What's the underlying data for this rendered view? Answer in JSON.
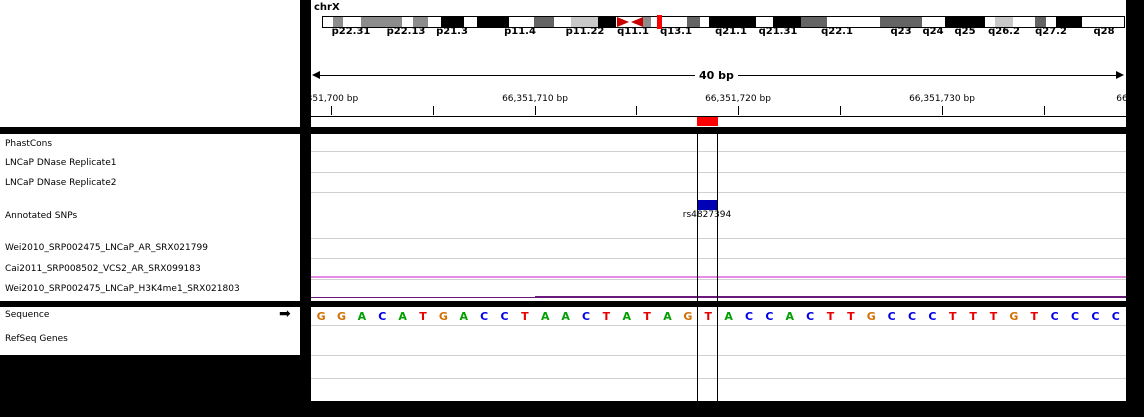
{
  "ideogram": {
    "chromosome": "chrX",
    "band_labels": [
      "p22.31",
      "p22.13",
      "p21.3",
      "p11.4",
      "p11.22",
      "q11.1",
      "q13.1",
      "q21.1",
      "q21.31",
      "q22.1",
      "q23",
      "q24",
      "q25",
      "q26.2",
      "q27.2",
      "q28"
    ]
  },
  "ruler": {
    "span_label": "40 bp",
    "ticks": [
      ",351,700 bp",
      "66,351,710 bp",
      "66,351,720 bp",
      "66,351,730 bp",
      "66"
    ]
  },
  "tracks": {
    "phastcons": "PhastCons",
    "dnase1": "LNCaP DNase Replicate1",
    "dnase2": "LNCaP DNase Replicate2",
    "snps": "Annotated SNPs",
    "wei_ar": "Wei2010_SRP002475_LNCaP_AR_SRX021799",
    "cai_ar": "Cai2011_SRP008502_VCS2_AR_SRX099183",
    "wei_h3k4": "Wei2010_SRP002475_LNCaP_H3K4me1_SRX021803",
    "sequence": "Sequence",
    "refseq": "RefSeq Genes"
  },
  "snp_feature": {
    "name": "rs4827394",
    "color": "#0000b4"
  },
  "sequence_arrow": "➡",
  "sequence_bases": [
    "G",
    "G",
    "A",
    "C",
    "A",
    "T",
    "G",
    "A",
    "C",
    "C",
    "T",
    "A",
    "A",
    "C",
    "T",
    "A",
    "T",
    "A",
    "G",
    "T",
    "A",
    "C",
    "C",
    "A",
    "C",
    "T",
    "T",
    "G",
    "C",
    "C",
    "C",
    "T",
    "T",
    "T",
    "G",
    "T",
    "C",
    "C",
    "C",
    "C"
  ],
  "base_colors": {
    "A": "#00a000",
    "C": "#0000e6",
    "G": "#d17105",
    "T": "#e60000"
  },
  "colors": {
    "cai_signal": "#e68ae6",
    "wei_h3k4_signal": "#6a1a7a",
    "current_region": "#ff0000"
  }
}
